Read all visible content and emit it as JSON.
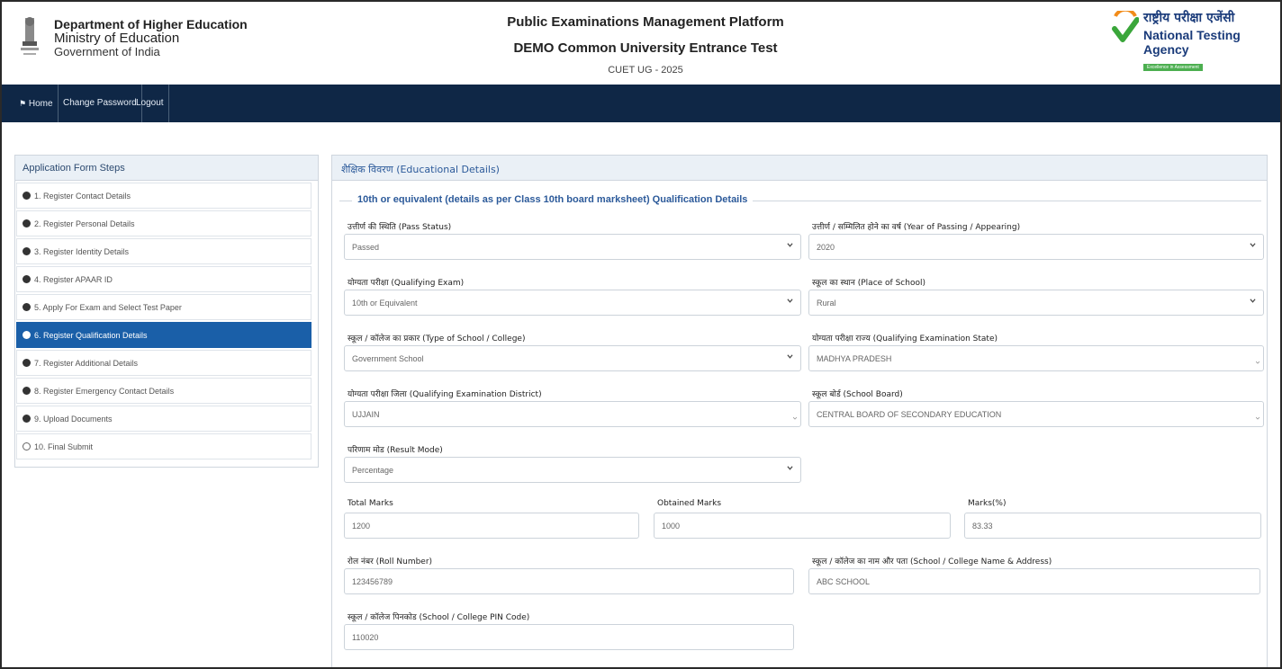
{
  "header": {
    "dept_line1": "Department of Higher Education",
    "dept_line2": "Ministry of Education",
    "dept_line3": "Government of India",
    "title": "Public Examinations Management Platform",
    "subtitle": "DEMO Common University Entrance Test",
    "session": "CUET UG - 2025",
    "nta_hindi": "राष्ट्रीय परीक्षा एजेंसी",
    "nta_english": "National Testing Agency",
    "nta_tagline": "Excellence in Assessment"
  },
  "nav": {
    "home": "Home",
    "change_password": "Change Password",
    "logout": "Logout"
  },
  "sidebar": {
    "title": "Application Form Steps",
    "steps": [
      "1. Register Contact Details",
      "2. Register Personal Details",
      "3. Register Identity Details",
      "4. Register APAAR ID",
      "5. Apply For Exam and Select Test Paper",
      "6. Register Qualification Details",
      "7. Register Additional Details",
      "8. Register Emergency Contact Details",
      "9. Upload Documents",
      "10. Final Submit"
    ],
    "active_index": 5
  },
  "panel": {
    "title": "शैक्षिक विवरण (Educational Details)",
    "section_legend": "10th or equivalent (details as per Class 10th board marksheet) Qualification Details"
  },
  "form": {
    "pass_status": {
      "label": "उत्तीर्ण की स्थिति (Pass Status)",
      "value": "Passed"
    },
    "year_of_passing": {
      "label": "उत्तीर्ण / सम्मिलित होने का वर्ष (Year of Passing / Appearing)",
      "value": "2020"
    },
    "qualifying_exam": {
      "label": "योग्यता परीक्षा (Qualifying Exam)",
      "value": "10th or Equivalent"
    },
    "place_of_school": {
      "label": "स्कूल का स्थान (Place of School)",
      "value": "Rural"
    },
    "type_of_school": {
      "label": "स्कूल / कॉलेज का प्रकार (Type of School / College)",
      "value": "Government School"
    },
    "qualifying_state": {
      "label": "योग्यता परीक्षा राज्य (Qualifying Examination State)",
      "value": "MADHYA PRADESH"
    },
    "qualifying_district": {
      "label": "योग्यता परीक्षा जिला (Qualifying Examination District)",
      "value": "UJJAIN"
    },
    "school_board": {
      "label": "स्कूल बोर्ड (School Board)",
      "value": "CENTRAL BOARD OF SECONDARY EDUCATION"
    },
    "result_mode": {
      "label": "परिणाम मोड (Result Mode)",
      "value": "Percentage"
    },
    "total_marks": {
      "label": "Total Marks",
      "value": "1200"
    },
    "obtained_marks": {
      "label": "Obtained Marks",
      "value": "1000"
    },
    "marks_percent": {
      "label": "Marks(%)",
      "value": "83.33"
    },
    "roll_number": {
      "label": "रोल नंबर (Roll Number)",
      "value": "123456789"
    },
    "school_name": {
      "label": "स्कूल / कॉलेज का नाम और पता (School / College Name & Address)",
      "value": "ABC SCHOOL"
    },
    "school_pin": {
      "label": "स्कूल / कॉलेज पिनकोड (School / College PIN Code)",
      "value": "110020"
    }
  }
}
